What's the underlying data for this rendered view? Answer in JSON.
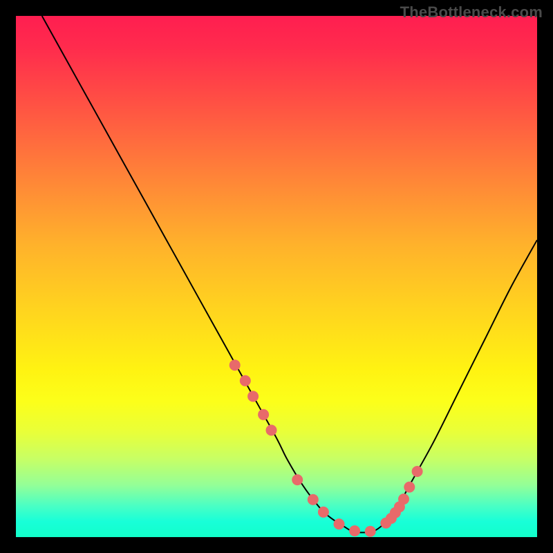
{
  "watermark": "TheBottleneck.com",
  "accent_dot_color": "#e86a6a",
  "curve_color": "#000000",
  "chart_data": {
    "type": "line",
    "title": "",
    "xlabel": "",
    "ylabel": "",
    "xlim": [
      0,
      100
    ],
    "ylim": [
      0,
      100
    ],
    "grid": false,
    "legend": false,
    "series": [
      {
        "name": "bottleneck-curve",
        "x": [
          5,
          10,
          15,
          20,
          25,
          30,
          35,
          40,
          45,
          50,
          52,
          55,
          58,
          60,
          63,
          65,
          68,
          70,
          73,
          75,
          80,
          85,
          90,
          95,
          100
        ],
        "values": [
          100,
          91,
          82,
          73,
          64,
          55,
          46,
          37,
          28,
          19,
          15,
          10,
          6,
          4,
          2,
          1,
          1,
          2,
          5,
          9,
          18,
          28,
          38,
          48,
          57
        ]
      }
    ],
    "highlight_dots": {
      "name": "threshold-markers",
      "x": [
        42,
        44,
        45.5,
        47.5,
        49,
        54,
        57,
        59,
        62,
        65,
        68,
        71,
        72,
        72.8,
        73.6,
        74.4,
        75.5,
        77
      ],
      "values": [
        33,
        30,
        27,
        23.5,
        20.5,
        11,
        7.2,
        4.8,
        2.5,
        1.2,
        1.1,
        2.7,
        3.6,
        4.7,
        5.8,
        7.3,
        9.6,
        12.6
      ]
    }
  }
}
